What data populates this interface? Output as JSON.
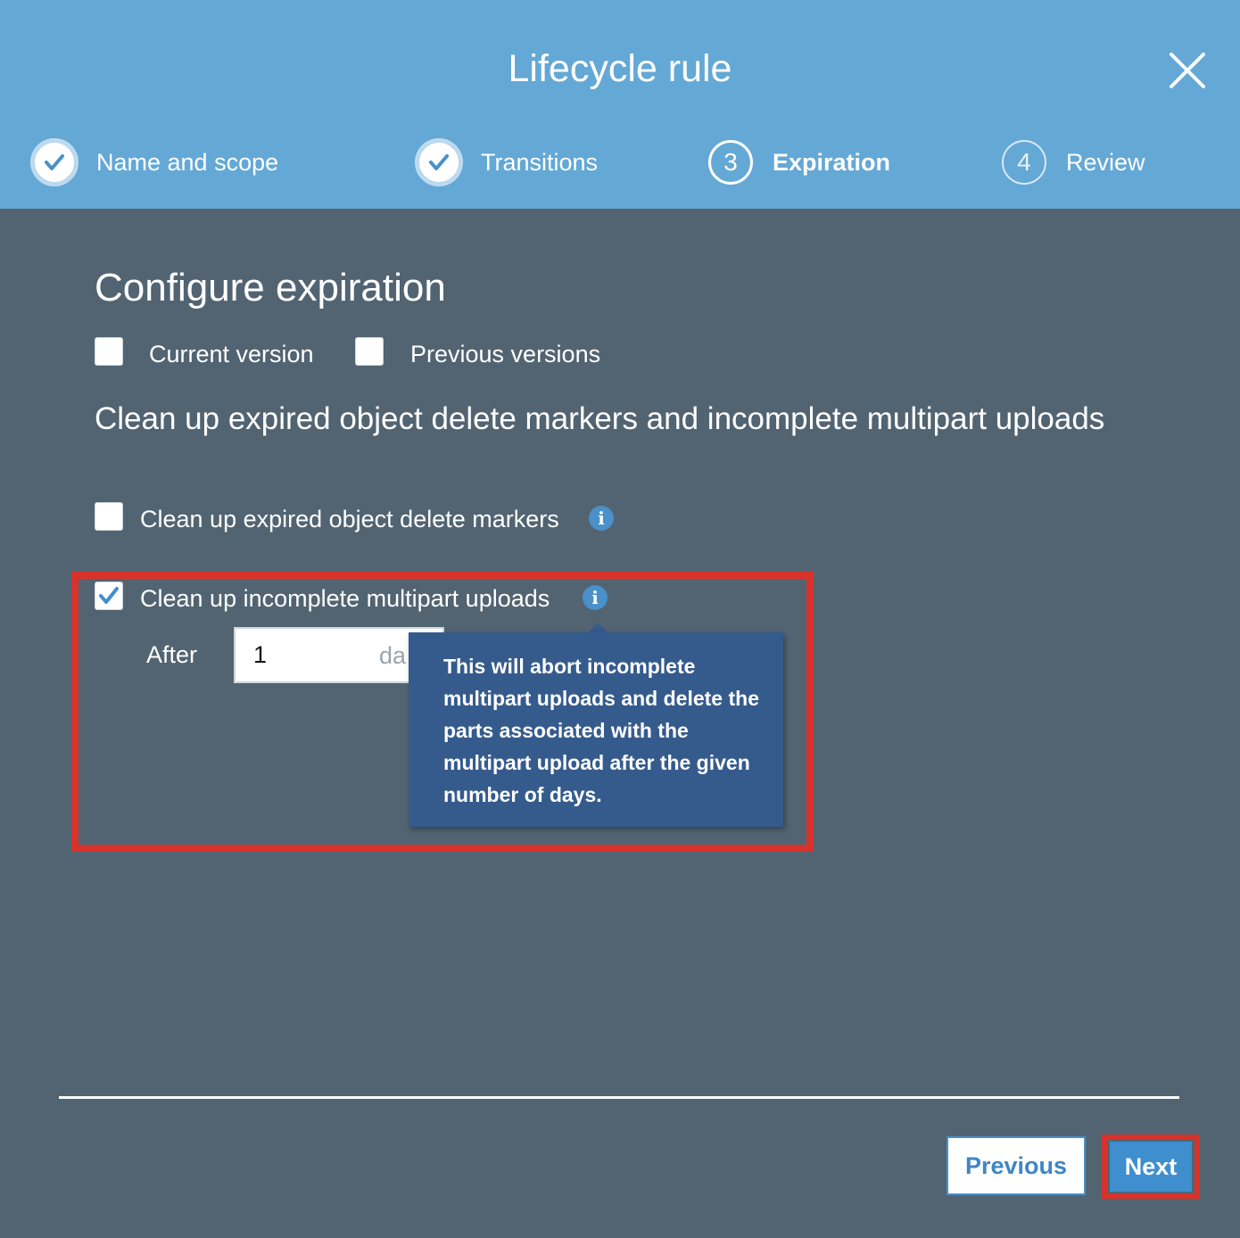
{
  "modal": {
    "title": "Lifecycle rule"
  },
  "steps": [
    {
      "number": "1",
      "label": "Name and scope",
      "state": "complete"
    },
    {
      "number": "2",
      "label": "Transitions",
      "state": "complete"
    },
    {
      "number": "3",
      "label": "Expiration",
      "state": "current"
    },
    {
      "number": "4",
      "label": "Review",
      "state": "upcoming"
    }
  ],
  "configure": {
    "title": "Configure expiration",
    "current_version": {
      "label": "Current version",
      "checked": false
    },
    "previous_versions": {
      "label": "Previous versions",
      "checked": false
    }
  },
  "cleanup": {
    "heading": "Clean up expired object delete markers and incomplete multipart uploads",
    "delete_markers": {
      "label": "Clean up expired object delete markers",
      "checked": false
    },
    "multipart": {
      "label": "Clean up incomplete multipart uploads",
      "checked": true,
      "after_label": "After",
      "days_value": "1",
      "unit_visible": "da"
    }
  },
  "tooltip": {
    "text": "This will abort incomplete multipart uploads and delete the parts associated with the multipart upload after the given number of days."
  },
  "footer": {
    "previous_label": "Previous",
    "next_label": "Next"
  },
  "colors": {
    "header_bg": "#64a8d6",
    "body_bg": "#526472",
    "tooltip_bg": "#355b8d",
    "highlight": "#d8322a",
    "accent": "#3f8fcf"
  },
  "icons": {
    "close": "close-icon",
    "step_done": "checkmark-circle-icon",
    "info": "info-icon",
    "checkbox_checked": "checkmark-icon"
  }
}
